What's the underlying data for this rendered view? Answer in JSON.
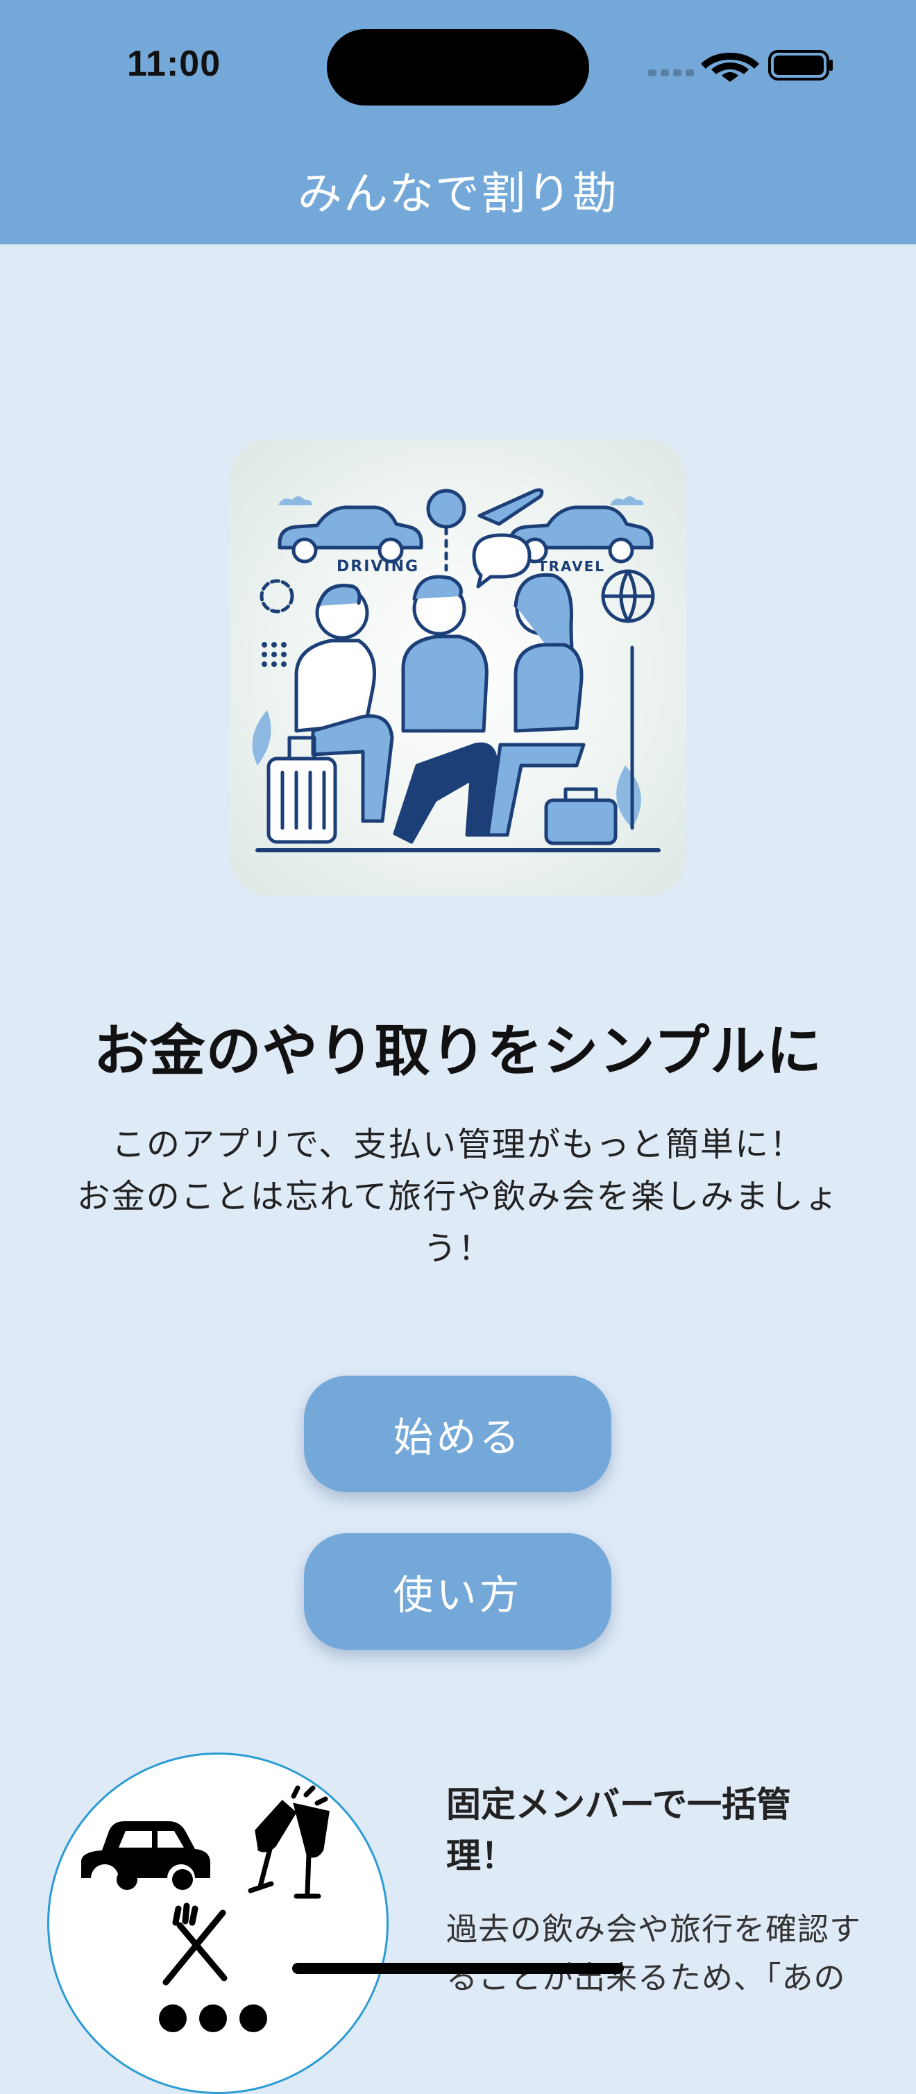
{
  "status_bar": {
    "time": "11:00"
  },
  "header": {
    "title": "みんなで割り勘"
  },
  "hero": {
    "illustration_labels": {
      "left": "DRIVING",
      "right": "TRAVEL"
    }
  },
  "main": {
    "headline": "お金のやり取りをシンプルに",
    "description_line1": "このアプリで、支払い管理がもっと簡単に！",
    "description_line2": "お金のことは忘れて旅行や飲み会を楽しみましょ",
    "description_line3": "う！"
  },
  "buttons": {
    "start": "始める",
    "how_to": "使い方"
  },
  "feature": {
    "title_line1": "固定メンバーで一括管",
    "title_line2": "理！",
    "text_line1": "過去の飲み会や旅行を確認す",
    "text_line2": "ることが出来るため、「あの"
  },
  "colors": {
    "header": "#74a8d8",
    "background": "#dfeaf7",
    "button": "#74a8d8",
    "circle_border": "#2a9bd3"
  },
  "icons": [
    "wifi-icon",
    "battery-icon",
    "cellular-signal-icon",
    "car-icon",
    "champagne-glasses-icon",
    "fork-knife-icon"
  ]
}
